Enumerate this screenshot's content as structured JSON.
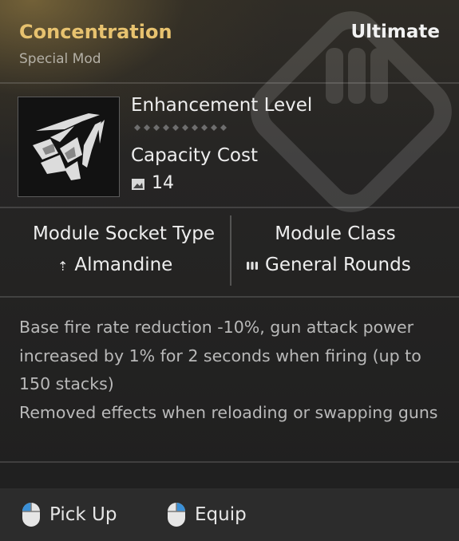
{
  "item": {
    "name": "Concentration",
    "type": "Special Mod",
    "rarity": "Ultimate"
  },
  "stats": {
    "enhancement_label": "Enhancement Level",
    "capacity_label": "Capacity Cost",
    "capacity_value": "14"
  },
  "socket": {
    "type_label": "Module Socket Type",
    "type_value": "Almandine",
    "type_icon": "almandine-socket-icon"
  },
  "class": {
    "label": "Module Class",
    "value": "General Rounds",
    "icon": "general-rounds-icon"
  },
  "description": {
    "line1": "Base fire rate reduction -10%, gun attack power increased by 1% for 2 seconds when firing (up to 150 stacks)",
    "line2": "Removed effects when reloading or swapping guns"
  },
  "actions": {
    "pickup_label": "Pick Up",
    "equip_label": "Equip"
  },
  "colors": {
    "title": "#e7c26f",
    "text": "#eeeeee",
    "desc": "#b9b9b9"
  }
}
